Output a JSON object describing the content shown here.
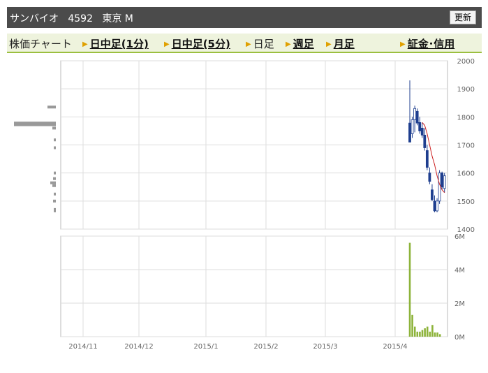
{
  "header": {
    "stock_name": "サンバイオ",
    "code": "4592",
    "market": "東京 M",
    "refresh_label": "更新"
  },
  "tabs": [
    {
      "label": "株価チャート",
      "link": false,
      "arrow": false
    },
    {
      "label": "日中足(1分)",
      "link": true,
      "arrow": true
    },
    {
      "label": "日中足(5分)",
      "link": true,
      "arrow": true
    },
    {
      "label": "日足",
      "link": false,
      "arrow": true
    },
    {
      "label": "週足",
      "link": true,
      "arrow": true
    },
    {
      "label": "月足",
      "link": true,
      "arrow": true
    },
    {
      "label": "証金･信用",
      "link": true,
      "arrow": true
    }
  ],
  "colors": {
    "candle": "#1f3f8f",
    "moving_average": "#cc2222",
    "volume": "#8db33a",
    "profile": "#999999",
    "tab_accent": "#9bbf3f",
    "header_bg": "#4b4b4b"
  },
  "chart_data": {
    "type": "candlestick",
    "price_axis": {
      "ticks": [
        1400,
        1500,
        1600,
        1700,
        1800,
        1900,
        2000
      ],
      "range": [
        1400,
        2000
      ]
    },
    "volume_axis": {
      "ticks": [
        "0M",
        "2M",
        "4M",
        "6M"
      ],
      "range": [
        0,
        6
      ]
    },
    "x_ticks": [
      "2014/11",
      "2014/12",
      "2015/1",
      "2015/2",
      "2015/3",
      "2015/4"
    ],
    "candles": [
      {
        "o": 1778,
        "h": 1930,
        "l": 1710,
        "c": 1710
      },
      {
        "o": 1740,
        "h": 1800,
        "l": 1725,
        "c": 1790
      },
      {
        "o": 1790,
        "h": 1840,
        "l": 1745,
        "c": 1830
      },
      {
        "o": 1820,
        "h": 1830,
        "l": 1770,
        "c": 1778
      },
      {
        "o": 1780,
        "h": 1800,
        "l": 1740,
        "c": 1750
      },
      {
        "o": 1760,
        "h": 1780,
        "l": 1725,
        "c": 1735
      },
      {
        "o": 1735,
        "h": 1760,
        "l": 1680,
        "c": 1690
      },
      {
        "o": 1680,
        "h": 1700,
        "l": 1610,
        "c": 1620
      },
      {
        "o": 1600,
        "h": 1620,
        "l": 1560,
        "c": 1570
      },
      {
        "o": 1540,
        "h": 1560,
        "l": 1500,
        "c": 1505
      },
      {
        "o": 1500,
        "h": 1520,
        "l": 1460,
        "c": 1465
      },
      {
        "o": 1465,
        "h": 1510,
        "l": 1460,
        "c": 1500
      },
      {
        "o": 1500,
        "h": 1610,
        "l": 1490,
        "c": 1600
      },
      {
        "o": 1600,
        "h": 1605,
        "l": 1540,
        "c": 1550
      },
      {
        "o": 1545,
        "h": 1600,
        "l": 1530,
        "c": 1590
      }
    ],
    "moving_average": [
      1780,
      1770,
      1740,
      1700,
      1660,
      1630,
      1590,
      1560,
      1540,
      1530
    ],
    "volumes_m": [
      5.6,
      1.3,
      0.6,
      0.3,
      0.3,
      0.4,
      0.5,
      0.6,
      0.3,
      0.7,
      0.25,
      0.25,
      0.15
    ],
    "price_profile": [
      {
        "price": 1835,
        "len": 12
      },
      {
        "price": 1778,
        "len": 60
      },
      {
        "price": 1772,
        "len": 60
      },
      {
        "price": 1760,
        "len": 5
      },
      {
        "price": 1718,
        "len": 3
      },
      {
        "price": 1690,
        "len": 3
      },
      {
        "price": 1600,
        "len": 3
      },
      {
        "price": 1580,
        "len": 4
      },
      {
        "price": 1565,
        "len": 8
      },
      {
        "price": 1555,
        "len": 5
      },
      {
        "price": 1525,
        "len": 3
      },
      {
        "price": 1500,
        "len": 4
      },
      {
        "price": 1470,
        "len": 3
      },
      {
        "price": 1465,
        "len": 3
      }
    ]
  }
}
